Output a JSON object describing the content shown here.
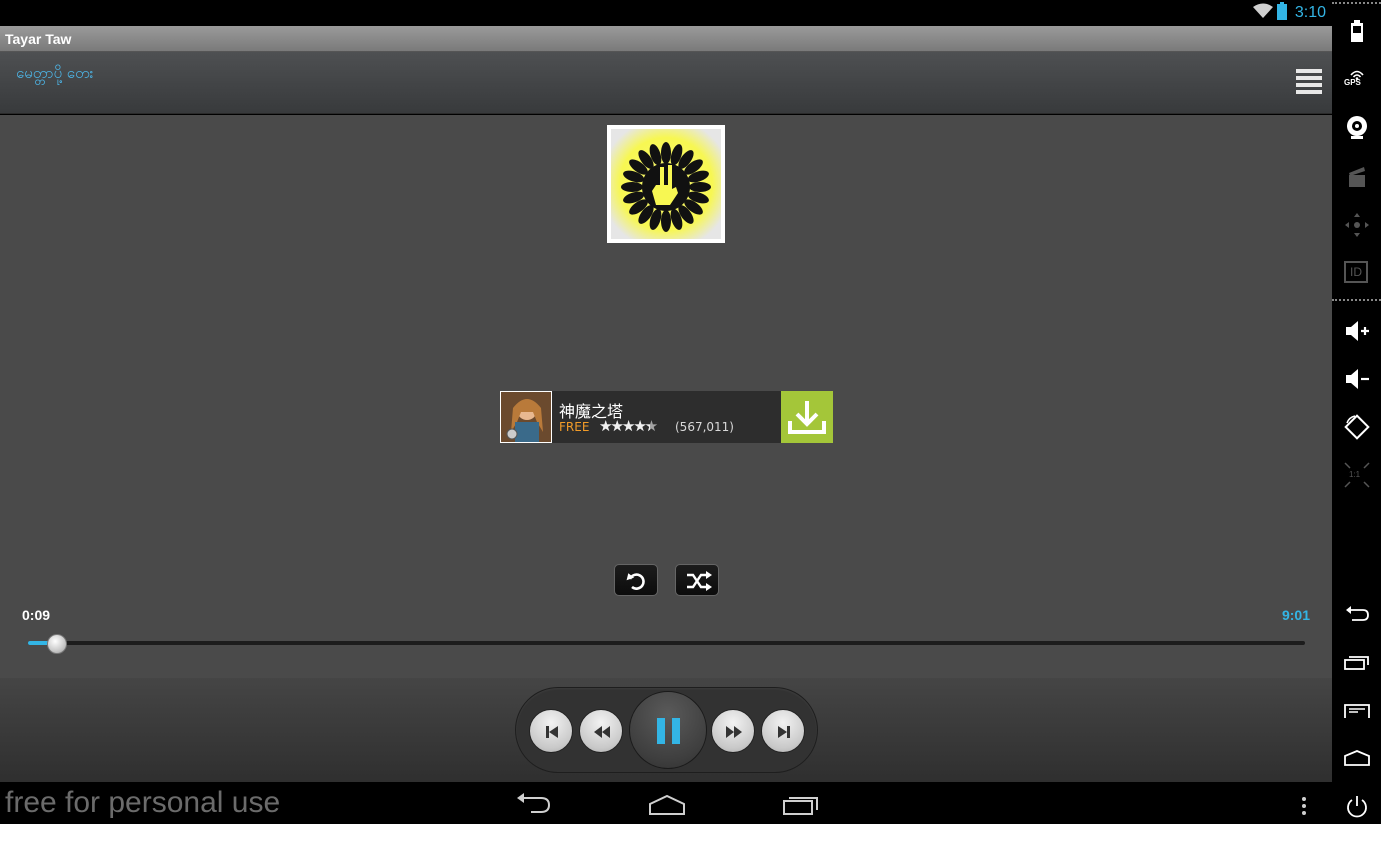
{
  "status_bar": {
    "time": "3:10"
  },
  "window": {
    "title": "Tayar Taw"
  },
  "header": {
    "track_title": "မေတ္တာပို့ တေး"
  },
  "ad": {
    "title": "神魔之塔",
    "price": "FREE",
    "stars": "★★★★★",
    "rating_count": "(567,011)",
    "rating": 4.5
  },
  "player": {
    "elapsed": "0:09",
    "total": "9:01",
    "progress": 0.0166
  },
  "nav": {
    "watermark": "free for personal use"
  },
  "side_panel": {
    "gps_label": "GPS",
    "id_label": "ID",
    "scale_label": "1:1"
  },
  "colors": {
    "accent": "#33b5e5",
    "ad_download": "#a4c639",
    "ad_free": "#f39c28",
    "album_art_bg": "#f7f752"
  },
  "icons": {
    "status": [
      "wifi-icon",
      "battery-icon"
    ],
    "header": [
      "menu-icon"
    ],
    "controls": [
      "repeat-icon",
      "shuffle-icon",
      "previous-icon",
      "rewind-icon",
      "pause-icon",
      "fast-forward-icon",
      "next-icon"
    ],
    "nav": [
      "back-icon",
      "home-icon",
      "recents-icon",
      "overflow-icon"
    ],
    "side_panel": [
      "battery-icon",
      "gps-icon",
      "camera-icon",
      "media-icon",
      "dpad-icon",
      "id-icon",
      "volume-up-icon",
      "volume-down-icon",
      "rotate-icon",
      "scale-icon",
      "back-icon",
      "recents-icon",
      "menu-icon",
      "home-icon",
      "power-icon"
    ]
  }
}
